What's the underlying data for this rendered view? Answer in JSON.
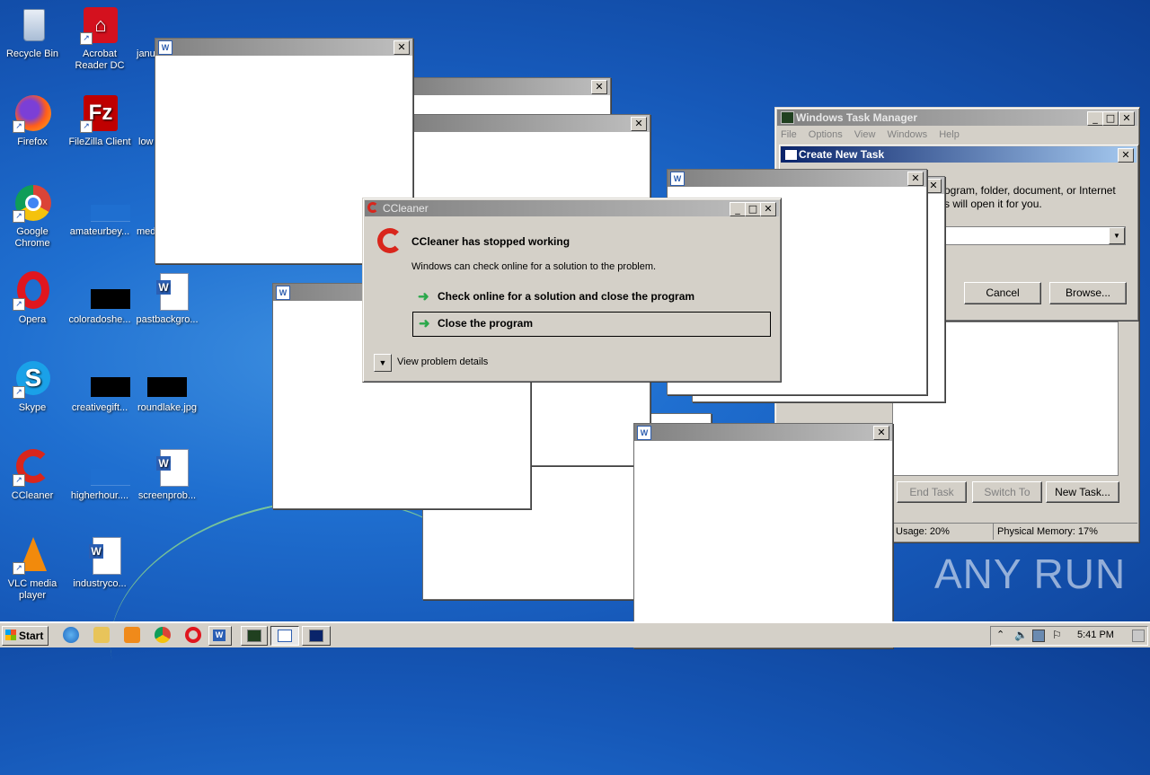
{
  "desktop": {
    "icons": [
      {
        "label": "Recycle Bin",
        "icon": "recycle-bin-icon"
      },
      {
        "label": "Acrobat Reader DC",
        "icon": "acrobat-icon"
      },
      {
        "label": "janu",
        "icon": "document-icon"
      },
      {
        "label": "Firefox",
        "icon": "firefox-icon"
      },
      {
        "label": "FileZilla Client",
        "icon": "filezilla-icon"
      },
      {
        "label": "low",
        "icon": "document-icon"
      },
      {
        "label": "Google Chrome",
        "icon": "chrome-icon"
      },
      {
        "label": "amateurbey...",
        "icon": "image-icon"
      },
      {
        "label": "med",
        "icon": "document-icon"
      },
      {
        "label": "Opera",
        "icon": "opera-icon"
      },
      {
        "label": "coloradoshe...",
        "icon": "image-icon"
      },
      {
        "label": "pastbackgro...",
        "icon": "word-document-icon"
      },
      {
        "label": "Skype",
        "icon": "skype-icon"
      },
      {
        "label": "creativegift...",
        "icon": "image-icon"
      },
      {
        "label": "roundlake.jpg",
        "icon": "image-icon"
      },
      {
        "label": "CCleaner",
        "icon": "ccleaner-icon"
      },
      {
        "label": "higherhour....",
        "icon": "image-icon"
      },
      {
        "label": "screenprob...",
        "icon": "word-document-icon"
      },
      {
        "label": "VLC media player",
        "icon": "vlc-icon"
      },
      {
        "label": "industryco...",
        "icon": "word-document-icon"
      }
    ]
  },
  "error_dialog": {
    "title": "CCleaner",
    "heading": "CCleaner has stopped working",
    "message": "Windows can check online for a solution to the problem.",
    "option_check_online": "Check online for a solution and close the program",
    "option_close": "Close the program",
    "details_toggle": "View problem details"
  },
  "task_manager": {
    "title": "Windows Task Manager",
    "menu": [
      "File",
      "Options",
      "View",
      "Windows",
      "Help"
    ],
    "buttons": {
      "end_task": "End Task",
      "switch_to": "Switch To",
      "new_task": "New Task..."
    },
    "status": {
      "usage": "Usage: 20%",
      "physical_memory": "Physical Memory: 17%"
    }
  },
  "create_task_dialog": {
    "title": "Create New Task",
    "text_line1": "ogram, folder, document, or Internet",
    "text_line2": "s will open it for you.",
    "cancel": "Cancel",
    "browse": "Browse..."
  },
  "taskbar": {
    "start_label": "Start",
    "clock": "5:41 PM"
  },
  "watermark": {
    "text": "ANY RUN"
  },
  "colors": {
    "desktop": "#1f6fd0",
    "dialog_face": "#d4d0c8",
    "titlebar_active": "#0a246a",
    "arrow_green": "#2aa84a"
  }
}
